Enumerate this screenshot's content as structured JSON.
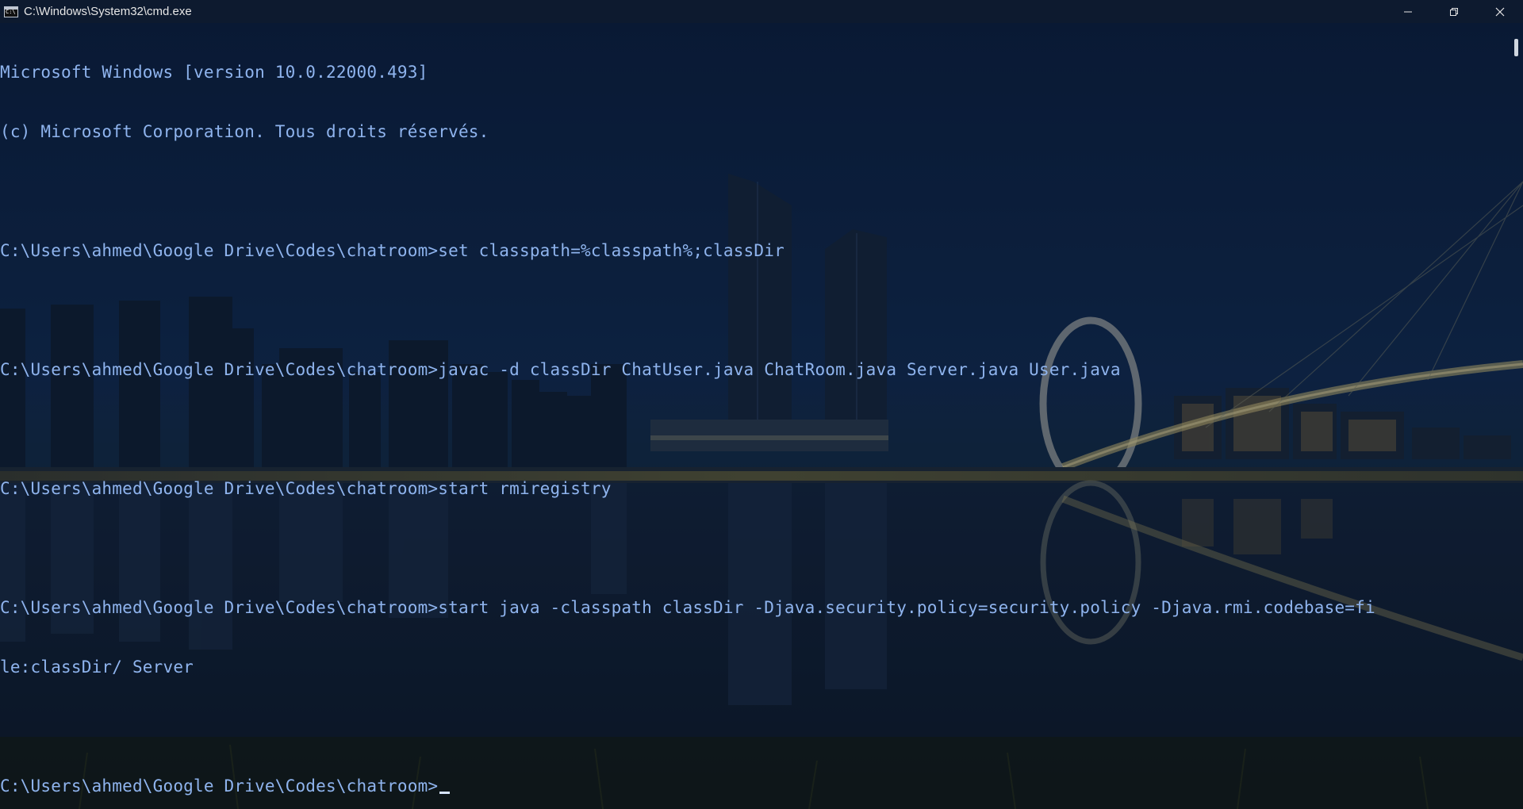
{
  "window": {
    "title": "C:\\Windows\\System32\\cmd.exe",
    "app_icon": "cmd-icon",
    "controls": [
      "minimize-icon",
      "restore-icon",
      "close-icon"
    ]
  },
  "console": {
    "lines": [
      "Microsoft Windows [version 10.0.22000.493]",
      "(c) Microsoft Corporation. Tous droits réservés.",
      "",
      "C:\\Users\\ahmed\\Google Drive\\Codes\\chatroom>set classpath=%classpath%;classDir",
      "",
      "C:\\Users\\ahmed\\Google Drive\\Codes\\chatroom>javac -d classDir ChatUser.java ChatRoom.java Server.java User.java",
      "",
      "C:\\Users\\ahmed\\Google Drive\\Codes\\chatroom>start rmiregistry",
      "",
      "C:\\Users\\ahmed\\Google Drive\\Codes\\chatroom>start java -classpath classDir -Djava.security.policy=security.policy -Djava.rmi.codebase=fi",
      "le:classDir/ Server",
      "",
      "C:\\Users\\ahmed\\Google Drive\\Codes\\chatroom>"
    ]
  },
  "colors": {
    "titlebar": "#0d1a2f",
    "console_text": "#8fb4ee",
    "background_sky": "#0b1a33"
  }
}
